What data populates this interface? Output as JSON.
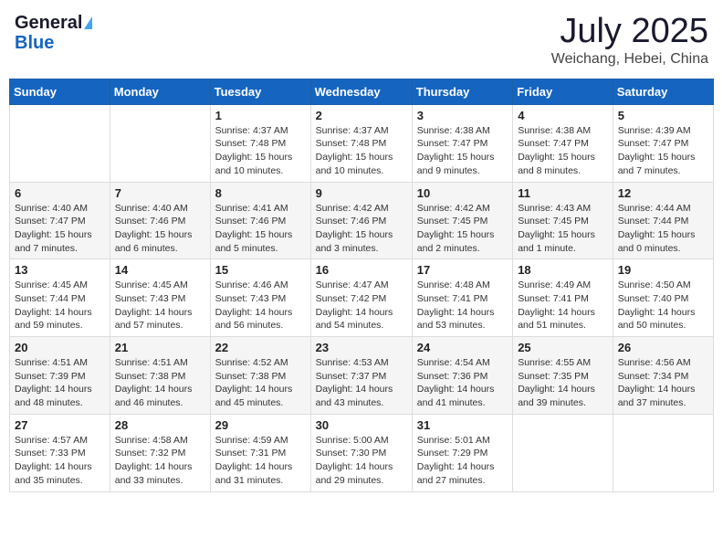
{
  "header": {
    "logo_general": "General",
    "logo_blue": "Blue",
    "title": "July 2025",
    "subtitle": "Weichang, Hebei, China"
  },
  "days_of_week": [
    "Sunday",
    "Monday",
    "Tuesday",
    "Wednesday",
    "Thursday",
    "Friday",
    "Saturday"
  ],
  "weeks": [
    [
      {
        "day": "",
        "detail": ""
      },
      {
        "day": "",
        "detail": ""
      },
      {
        "day": "1",
        "detail": "Sunrise: 4:37 AM\nSunset: 7:48 PM\nDaylight: 15 hours\nand 10 minutes."
      },
      {
        "day": "2",
        "detail": "Sunrise: 4:37 AM\nSunset: 7:48 PM\nDaylight: 15 hours\nand 10 minutes."
      },
      {
        "day": "3",
        "detail": "Sunrise: 4:38 AM\nSunset: 7:47 PM\nDaylight: 15 hours\nand 9 minutes."
      },
      {
        "day": "4",
        "detail": "Sunrise: 4:38 AM\nSunset: 7:47 PM\nDaylight: 15 hours\nand 8 minutes."
      },
      {
        "day": "5",
        "detail": "Sunrise: 4:39 AM\nSunset: 7:47 PM\nDaylight: 15 hours\nand 7 minutes."
      }
    ],
    [
      {
        "day": "6",
        "detail": "Sunrise: 4:40 AM\nSunset: 7:47 PM\nDaylight: 15 hours\nand 7 minutes."
      },
      {
        "day": "7",
        "detail": "Sunrise: 4:40 AM\nSunset: 7:46 PM\nDaylight: 15 hours\nand 6 minutes."
      },
      {
        "day": "8",
        "detail": "Sunrise: 4:41 AM\nSunset: 7:46 PM\nDaylight: 15 hours\nand 5 minutes."
      },
      {
        "day": "9",
        "detail": "Sunrise: 4:42 AM\nSunset: 7:46 PM\nDaylight: 15 hours\nand 3 minutes."
      },
      {
        "day": "10",
        "detail": "Sunrise: 4:42 AM\nSunset: 7:45 PM\nDaylight: 15 hours\nand 2 minutes."
      },
      {
        "day": "11",
        "detail": "Sunrise: 4:43 AM\nSunset: 7:45 PM\nDaylight: 15 hours\nand 1 minute."
      },
      {
        "day": "12",
        "detail": "Sunrise: 4:44 AM\nSunset: 7:44 PM\nDaylight: 15 hours\nand 0 minutes."
      }
    ],
    [
      {
        "day": "13",
        "detail": "Sunrise: 4:45 AM\nSunset: 7:44 PM\nDaylight: 14 hours\nand 59 minutes."
      },
      {
        "day": "14",
        "detail": "Sunrise: 4:45 AM\nSunset: 7:43 PM\nDaylight: 14 hours\nand 57 minutes."
      },
      {
        "day": "15",
        "detail": "Sunrise: 4:46 AM\nSunset: 7:43 PM\nDaylight: 14 hours\nand 56 minutes."
      },
      {
        "day": "16",
        "detail": "Sunrise: 4:47 AM\nSunset: 7:42 PM\nDaylight: 14 hours\nand 54 minutes."
      },
      {
        "day": "17",
        "detail": "Sunrise: 4:48 AM\nSunset: 7:41 PM\nDaylight: 14 hours\nand 53 minutes."
      },
      {
        "day": "18",
        "detail": "Sunrise: 4:49 AM\nSunset: 7:41 PM\nDaylight: 14 hours\nand 51 minutes."
      },
      {
        "day": "19",
        "detail": "Sunrise: 4:50 AM\nSunset: 7:40 PM\nDaylight: 14 hours\nand 50 minutes."
      }
    ],
    [
      {
        "day": "20",
        "detail": "Sunrise: 4:51 AM\nSunset: 7:39 PM\nDaylight: 14 hours\nand 48 minutes."
      },
      {
        "day": "21",
        "detail": "Sunrise: 4:51 AM\nSunset: 7:38 PM\nDaylight: 14 hours\nand 46 minutes."
      },
      {
        "day": "22",
        "detail": "Sunrise: 4:52 AM\nSunset: 7:38 PM\nDaylight: 14 hours\nand 45 minutes."
      },
      {
        "day": "23",
        "detail": "Sunrise: 4:53 AM\nSunset: 7:37 PM\nDaylight: 14 hours\nand 43 minutes."
      },
      {
        "day": "24",
        "detail": "Sunrise: 4:54 AM\nSunset: 7:36 PM\nDaylight: 14 hours\nand 41 minutes."
      },
      {
        "day": "25",
        "detail": "Sunrise: 4:55 AM\nSunset: 7:35 PM\nDaylight: 14 hours\nand 39 minutes."
      },
      {
        "day": "26",
        "detail": "Sunrise: 4:56 AM\nSunset: 7:34 PM\nDaylight: 14 hours\nand 37 minutes."
      }
    ],
    [
      {
        "day": "27",
        "detail": "Sunrise: 4:57 AM\nSunset: 7:33 PM\nDaylight: 14 hours\nand 35 minutes."
      },
      {
        "day": "28",
        "detail": "Sunrise: 4:58 AM\nSunset: 7:32 PM\nDaylight: 14 hours\nand 33 minutes."
      },
      {
        "day": "29",
        "detail": "Sunrise: 4:59 AM\nSunset: 7:31 PM\nDaylight: 14 hours\nand 31 minutes."
      },
      {
        "day": "30",
        "detail": "Sunrise: 5:00 AM\nSunset: 7:30 PM\nDaylight: 14 hours\nand 29 minutes."
      },
      {
        "day": "31",
        "detail": "Sunrise: 5:01 AM\nSunset: 7:29 PM\nDaylight: 14 hours\nand 27 minutes."
      },
      {
        "day": "",
        "detail": ""
      },
      {
        "day": "",
        "detail": ""
      }
    ]
  ]
}
